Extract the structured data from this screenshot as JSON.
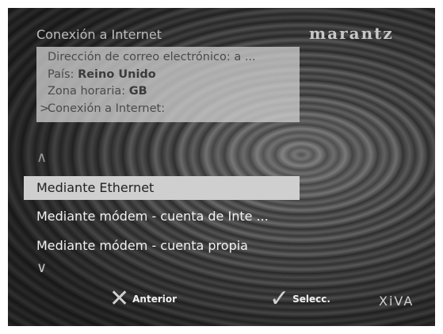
{
  "header": {
    "title": "Conexión a Internet",
    "brand": "marantz"
  },
  "info_panel": {
    "email_row": "Dirección de correo electrónico: a ...",
    "country_label": "País:",
    "country_value": "Reino Unido",
    "timezone_label": "Zona horaria:",
    "timezone_value": "GB",
    "connection_row": "Conexión a Internet:",
    "cursor_glyph": ">"
  },
  "options": [
    {
      "label": "Mediante Ethernet",
      "selected": true
    },
    {
      "label": "Mediante módem - cuenta de Inte ...",
      "selected": false
    },
    {
      "label": "Mediante módem - cuenta propia",
      "selected": false
    }
  ],
  "scroll": {
    "up_glyph": "∧",
    "down_glyph": "∨"
  },
  "footer": {
    "back_label": "Anterior",
    "back_icon": "x-icon",
    "select_label": "Selecc.",
    "select_icon": "check-icon",
    "xiva_logo": "XiVA"
  }
}
